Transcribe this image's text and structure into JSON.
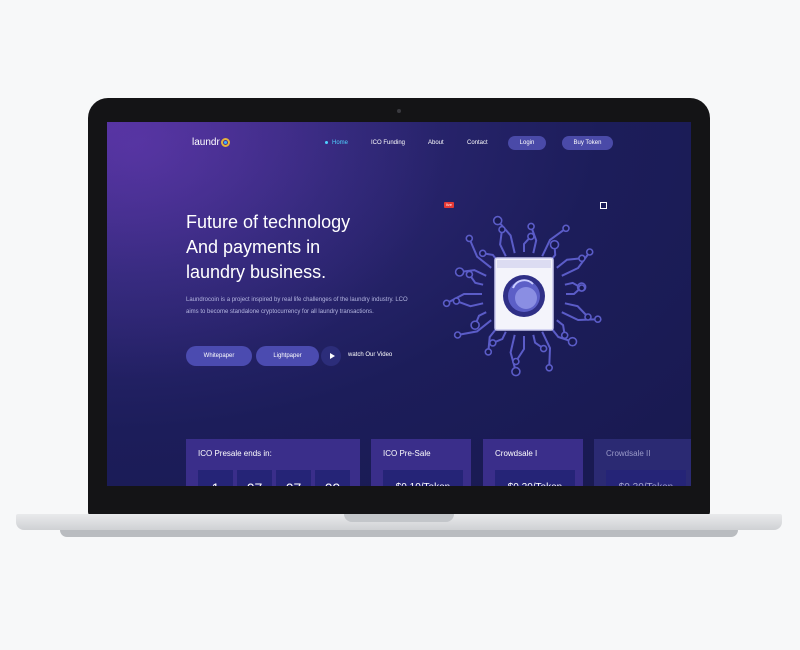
{
  "brand": {
    "name": "laundr"
  },
  "nav": {
    "items": [
      "Home",
      "ICO Funding",
      "About",
      "Contact"
    ],
    "login_label": "Login",
    "buy_label": "Buy Token"
  },
  "hero": {
    "headline": [
      "Future of technology",
      "And payments in",
      "laundry business."
    ],
    "description": "Laundrocoin is a project inspired by real life challenges of the laundry industry. LCO aims to become standalone cryptocurrency for all laundry transactions.",
    "whitepaper_label": "Whitepaper",
    "lightpaper_label": "Lightpaper",
    "video_label": "watch Our Video",
    "badge_label": "live"
  },
  "cards": {
    "presale": {
      "title": "ICO Presale ends in:",
      "digits": [
        "1",
        "07",
        "07",
        "09"
      ]
    },
    "pre_sale": {
      "title": "ICO Pre-Sale",
      "price": "$0.10/Token"
    },
    "crowdsale1": {
      "title": "Crowdsale I",
      "price": "$0.20/Token"
    },
    "crowdsale2": {
      "title": "Crowdsale II",
      "price": "$0.30/Token"
    }
  },
  "colors": {
    "background": "#f7f8f9",
    "screen_bg": "#1c1d5a",
    "accent": "#4fd1ff",
    "button": "#4a4aa8",
    "card": "#3a2e8a"
  },
  "icons": [
    "play-icon",
    "expand-icon",
    "washing-machine-icon",
    "circuit-graphic"
  ]
}
